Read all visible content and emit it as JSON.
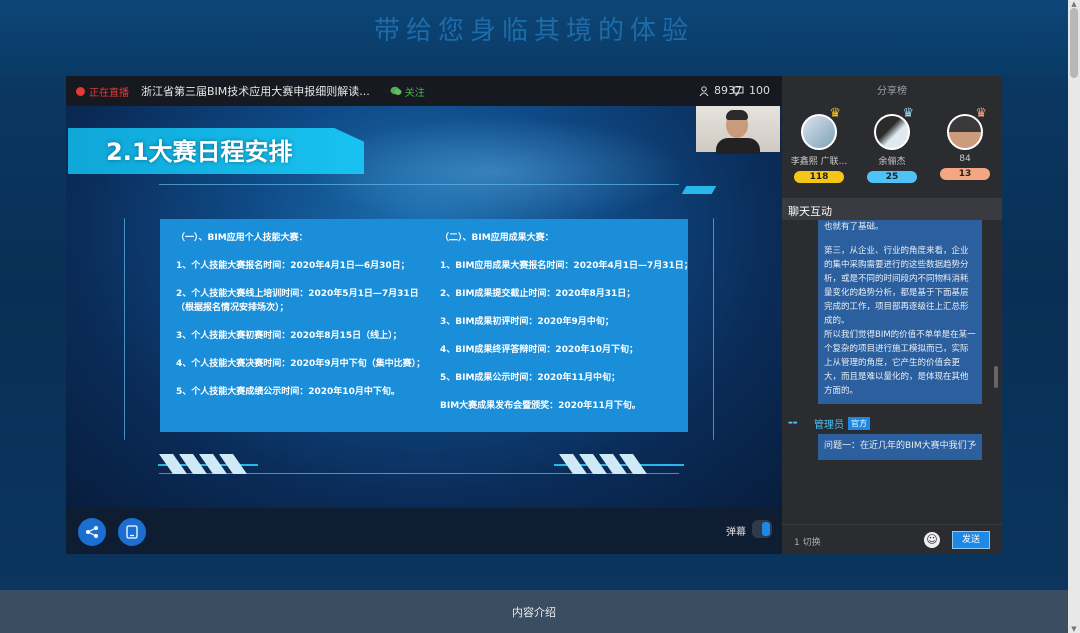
{
  "banner": {
    "title": "带给您身临其境的体验"
  },
  "player": {
    "live_label": "正在直播",
    "stream_title": "浙江省第三届BIM技术应用大赛申报细则解读...",
    "follow_label": "关注",
    "viewer_count": "8937",
    "comment_count": "100",
    "danmu_label": "弹幕"
  },
  "slide": {
    "heading": "2.1大赛日程安排",
    "left_column": [
      "（一）、BIM应用个人技能大赛：",
      "1、个人技能大赛报名时间：2020年4月1日—6月30日；",
      "2、个人技能大赛线上培训时间：2020年5月1日—7月31日（根据报名情况安排场次）；",
      "3、个人技能大赛初赛时间：2020年8月15日（线上）；",
      "4、个人技能大赛决赛时间：2020年9月中下旬（集中比赛）；",
      "5、个人技能大赛成绩公示时间：2020年10月中下旬。"
    ],
    "right_column": [
      "（二）、BIM应用成果大赛：",
      "1、BIM应用成果大赛报名时间：2020年4月1日—7月31日；",
      "2、BIM成果提交截止时间：2020年8月31日；",
      "3、BIM成果初评时间：2020年9月中旬；",
      "4、BIM成果终评答辩时间：2020年10月下旬；",
      "5、BIM成果公示时间：2020年11月中旬；",
      "BIM大赛成果发布会暨颁奖：2020年11月下旬。"
    ]
  },
  "sidebar": {
    "rank_title": "分享榜",
    "ranks": [
      {
        "name": "李鑫熙 广联...",
        "count": "118",
        "color": "#f5c518"
      },
      {
        "name": "余俪杰",
        "count": "25",
        "color": "#4fc3f7"
      },
      {
        "name": "84",
        "count": "13",
        "color": "#f4a582"
      }
    ],
    "chat_header": "聊天互动",
    "message_lines": [
      "也就有了基础。",
      "",
      "第三，从企业、行业的角度来看，企业的集中采购需要进行的这些数据趋势分析，或是不同的时间段内不同物料消耗量变化的趋势分析，都是基于下面基层完成的工作，项目部再逐级往上汇总形成的。",
      "所以我们觉得BIM的价值不单单是在某一个复杂的项目进行施工模拟而已，实际上从管理的角度，它产生的价值会更大，而且是难以量化的，是体现在其他方面的。"
    ],
    "admin_name": "管理员",
    "official_badge": "官方",
    "question_text": "问题一：在近几年的BIM大赛中我们了",
    "switch_label": "1 切换",
    "send_label": "发送"
  },
  "footer": {
    "label": "内容介绍"
  }
}
